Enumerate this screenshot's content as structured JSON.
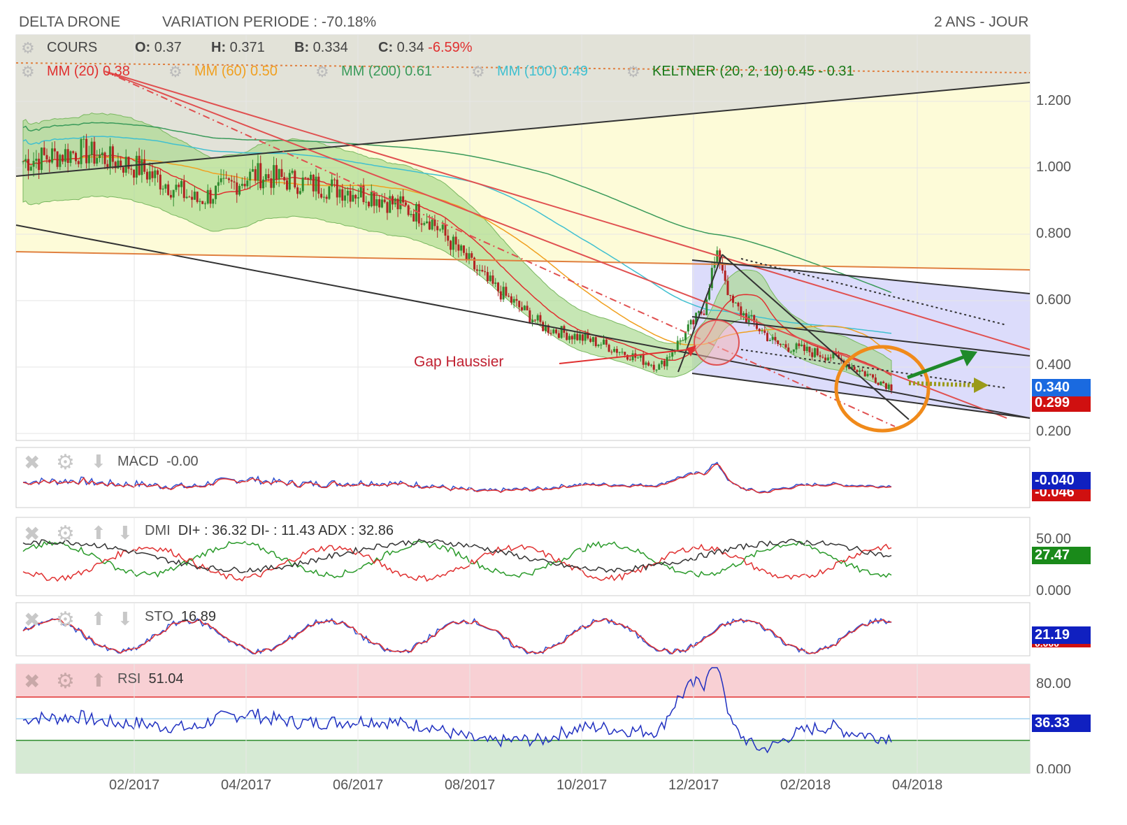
{
  "header": {
    "name": "DELTA DRONE",
    "variation": "VARIATION PERIODE : -70.18%",
    "period": "2 ANS - JOUR"
  },
  "price_panel": {
    "cours": "COURS",
    "o_label": "O:",
    "o_value": "0.37",
    "h_label": "H:",
    "h_value": "0.371",
    "b_label": "B:",
    "b_value": "0.334",
    "c_label": "C:",
    "c_value": "0.34",
    "c_change": "-6.59%",
    "mm20": "MM (20) 0.38",
    "mm60": "MM (60) 0.50",
    "mm200": "MM (200) 0.61",
    "mm100": "MM (100) 0.49",
    "keltner": "KELTNER (20, 2, 10) 0.45 - 0.31",
    "annotation": "Gap Haussier",
    "y_ticks": [
      "1.200",
      "1.000",
      "0.800",
      "0.600",
      "0.400",
      "0.200"
    ],
    "last_price": "0.340",
    "last_low": "0.299"
  },
  "macd_panel": {
    "label": "MACD",
    "value": "-0.00",
    "tag": "-0.040",
    "tag2": "-0.046"
  },
  "dmi_panel": {
    "label": "DMI",
    "values": "DI+ : 36.32 DI- : 11.43 ADX : 32.86",
    "ticks": [
      "50.00",
      "0.000"
    ],
    "tag": "27.47"
  },
  "sto_panel": {
    "label": "STO",
    "value": "16.89",
    "tag": "21.19",
    "tag2": "0.000"
  },
  "rsi_panel": {
    "label": "RSI",
    "value": "51.04",
    "ticks": [
      "80.00",
      "0.000"
    ],
    "tag": "36.33"
  },
  "x_labels": [
    "02/2017",
    "04/2017",
    "06/2017",
    "08/2017",
    "10/2017",
    "12/2017",
    "02/2018",
    "04/2018"
  ],
  "colors": {
    "bull": "#2e8b2e",
    "bear": "#b22222",
    "mm20": "#e03030",
    "mm60": "#f0a020",
    "mm200": "#3a9a5a",
    "mm100": "#40c0d0",
    "keltner": "#1a7a1a",
    "band": "#9acd7a",
    "channel": "#b0b0f0",
    "accent_blue": "#1030d0",
    "accent_red": "#d01010"
  },
  "chart_data": {
    "type": "line",
    "x": [
      "12/2016",
      "01/2017",
      "02/2017",
      "03/2017",
      "04/2017",
      "05/2017",
      "06/2017",
      "07/2017",
      "08/2017",
      "09/2017",
      "10/2017",
      "11/2017",
      "12/2017",
      "01/2018",
      "02/2018",
      "03/2018"
    ],
    "series": [
      {
        "name": "COURS",
        "values": [
          1.02,
          1.05,
          1.0,
          0.9,
          0.98,
          0.95,
          0.92,
          0.85,
          0.66,
          0.52,
          0.47,
          0.4,
          0.63,
          0.47,
          0.43,
          0.34
        ]
      }
    ],
    "ylim": [
      0.18,
      1.3
    ]
  }
}
